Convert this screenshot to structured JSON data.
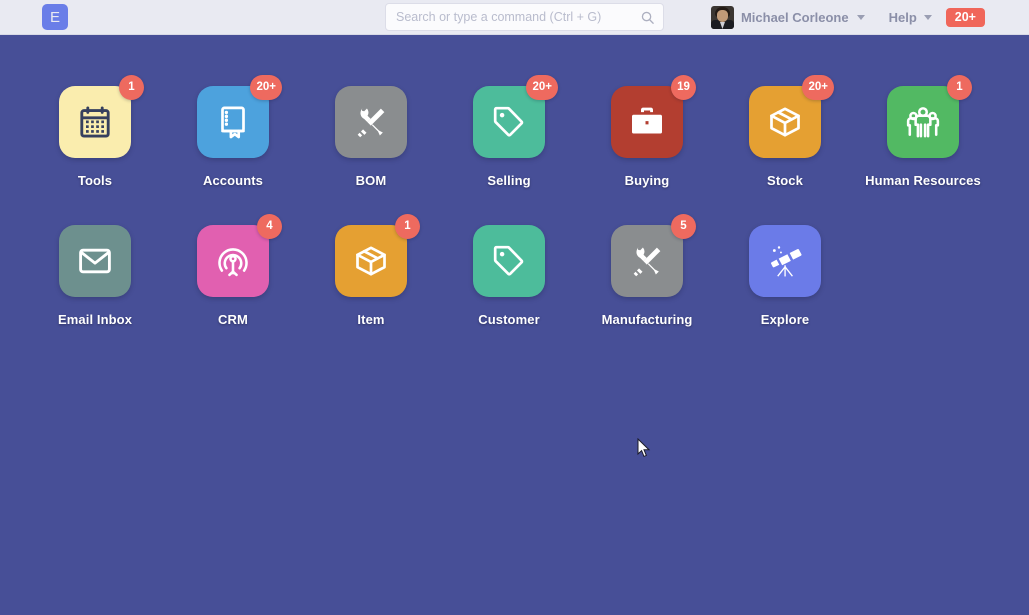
{
  "navbar": {
    "logo_text": "E",
    "logo_name": "erpnext-logo",
    "search": {
      "placeholder": "Search or type a command (Ctrl + G)",
      "value": "",
      "icon": "search-icon"
    },
    "user_name": "Michael Corleone",
    "help_label": "Help",
    "notification_badge": "20+",
    "accent_badge_color": "#F0665A",
    "background_color": "#E9EAF2"
  },
  "desktop": {
    "background_color": "#474F97",
    "apps": [
      {
        "label": "Tools",
        "icon": "calendar-icon",
        "color": "#FAEDAE",
        "icon_color": "#36405E",
        "badge": "1"
      },
      {
        "label": "Accounts",
        "icon": "ledger-book-icon",
        "color": "#4DA2DD",
        "icon_color": "#FFFFFF",
        "badge": "20+"
      },
      {
        "label": "BOM",
        "icon": "tools-icon",
        "color": "#8A8D8F",
        "icon_color": "#FFFFFF",
        "badge": ""
      },
      {
        "label": "Selling",
        "icon": "tag-icon",
        "color": "#4DBC9B",
        "icon_color": "#FFFFFF",
        "badge": "20+"
      },
      {
        "label": "Buying",
        "icon": "briefcase-icon",
        "color": "#B33E30",
        "icon_color": "#FFFFFF",
        "badge": "19"
      },
      {
        "label": "Stock",
        "icon": "box-icon",
        "color": "#E5A032",
        "icon_color": "#FFFFFF",
        "badge": "20+"
      },
      {
        "label": "Human Resources",
        "icon": "people-group-icon",
        "color": "#52B963",
        "icon_color": "#FFFFFF",
        "badge": "1"
      },
      {
        "label": "Email Inbox",
        "icon": "envelope-icon",
        "color": "#6D908E",
        "icon_color": "#FFFFFF",
        "badge": ""
      },
      {
        "label": "CRM",
        "icon": "crm-broadcast-icon",
        "color": "#E160B0",
        "icon_color": "#FFFFFF",
        "badge": "4"
      },
      {
        "label": "Item",
        "icon": "box-icon",
        "color": "#E5A032",
        "icon_color": "#FFFFFF",
        "badge": "1"
      },
      {
        "label": "Customer",
        "icon": "tag-icon",
        "color": "#4DBC9B",
        "icon_color": "#FFFFFF",
        "badge": ""
      },
      {
        "label": "Manufacturing",
        "icon": "tools-icon",
        "color": "#8A8D8F",
        "icon_color": "#FFFFFF",
        "badge": "5"
      },
      {
        "label": "Explore",
        "icon": "telescope-icon",
        "color": "#6B7BE8",
        "icon_color": "#FFFFFF",
        "badge": ""
      }
    ]
  }
}
